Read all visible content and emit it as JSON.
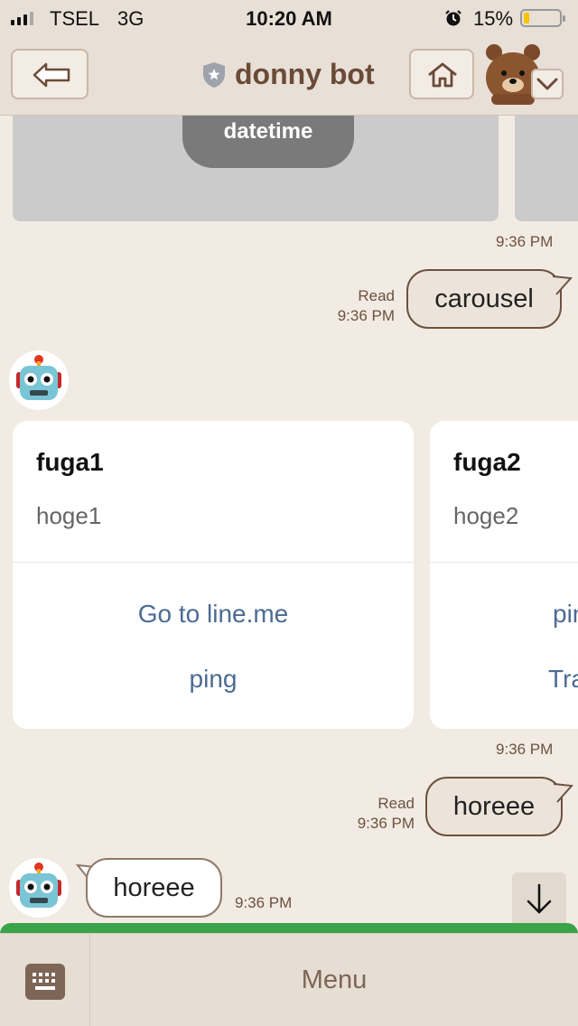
{
  "status_bar": {
    "carrier": "TSEL",
    "network": "3G",
    "time": "10:20 AM",
    "battery_percent": "15%",
    "battery_level": 0.15,
    "icons": [
      "signal-icon",
      "alarm-icon",
      "battery-icon"
    ]
  },
  "header": {
    "title": "donny bot",
    "icons": [
      "back-arrow-icon",
      "shield-icon",
      "home-icon",
      "bear-icon",
      "chevron-down-icon"
    ]
  },
  "chat": {
    "top_card_button": "datetime",
    "messages": [
      {
        "type": "time",
        "text": "9:36 PM"
      },
      {
        "type": "sent",
        "text": "carousel",
        "read_label": "Read",
        "time": "9:36 PM"
      },
      {
        "type": "carousel",
        "time": "9:36 PM",
        "cards": [
          {
            "title": "fuga1",
            "subtitle": "hoge1",
            "actions": [
              "Go to line.me",
              "ping"
            ]
          },
          {
            "title": "fuga2",
            "subtitle": "hoge2",
            "actions": [
              "pin",
              "Tra"
            ]
          }
        ]
      },
      {
        "type": "sent",
        "text": "horeee",
        "read_label": "Read",
        "time": "9:36 PM"
      },
      {
        "type": "received",
        "text": "horeee",
        "time": "9:36 PM"
      }
    ]
  },
  "bottom_bar": {
    "menu_label": "Menu",
    "icons": [
      "keyboard-icon"
    ]
  },
  "colors": {
    "background": "#f2ebe3",
    "header": "#e8dfd6",
    "title": "#6b4a38",
    "link": "#4c6b94",
    "grass": "#3ba34a"
  }
}
